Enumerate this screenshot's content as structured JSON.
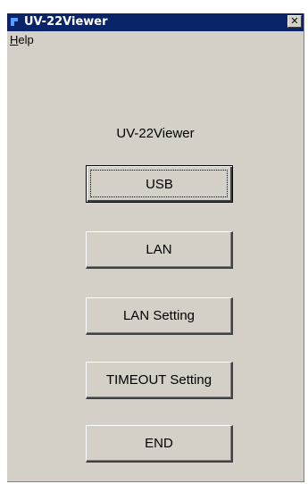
{
  "window": {
    "title": "UV-22Viewer",
    "close_label": "✕"
  },
  "menu": {
    "help_accel": "H",
    "help_rest": "elp"
  },
  "main": {
    "app_label": "UV-22Viewer",
    "buttons": {
      "usb": "USB",
      "lan": "LAN",
      "lan_setting": "LAN Setting",
      "timeout_setting": "TIMEOUT Setting",
      "end": "END"
    }
  },
  "colors": {
    "titlebar": "#0a246a",
    "face": "#d4d0c8"
  },
  "icons": [
    "app-icon",
    "close-icon"
  ]
}
